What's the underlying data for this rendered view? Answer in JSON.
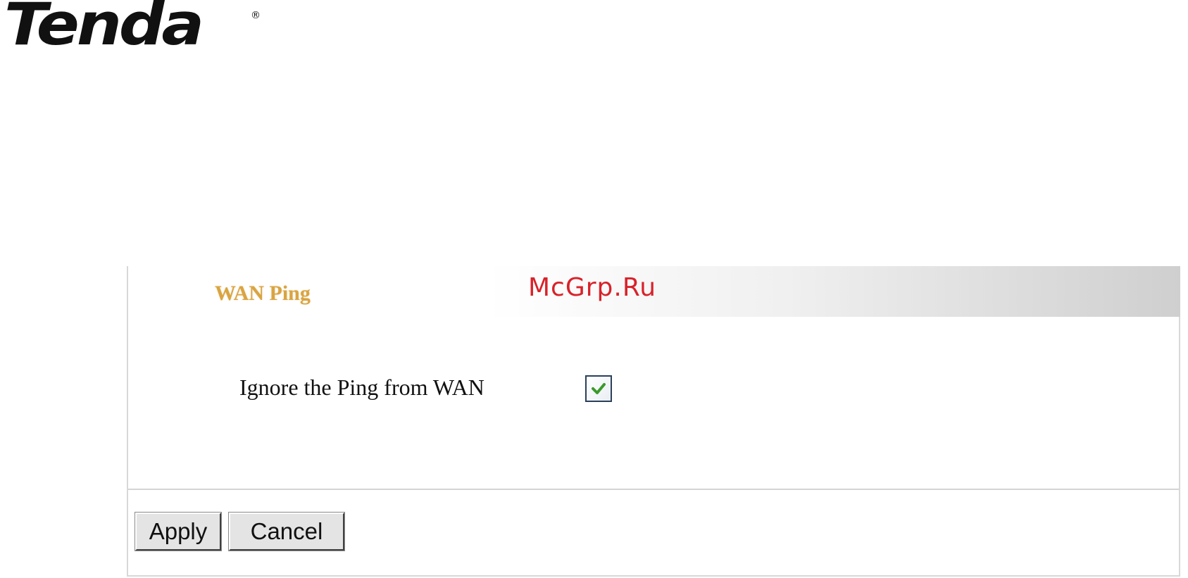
{
  "brand": {
    "logo_text": "Tenda",
    "registered_mark": "®"
  },
  "panel": {
    "title": "WAN Ping",
    "watermark": "McGrp.Ru",
    "options": [
      {
        "label": "Ignore the Ping from WAN",
        "checked": true
      }
    ]
  },
  "buttons": {
    "apply_label": "Apply",
    "cancel_label": "Cancel"
  },
  "colors": {
    "title": "#d9a441",
    "watermark": "#d8222a",
    "checkmark": "#3a9a2a"
  },
  "icons": {
    "checkbox": "checkmark-icon"
  }
}
